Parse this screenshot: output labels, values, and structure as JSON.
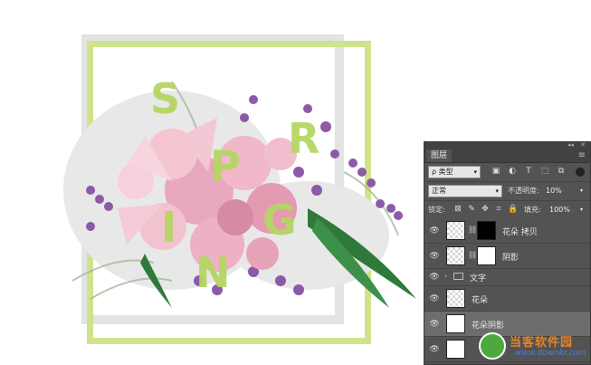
{
  "artwork": {
    "letters": [
      "S",
      "P",
      "R",
      "I",
      "N",
      "G"
    ],
    "frame_color": "#cfe38a",
    "letter_color": "#b5d664"
  },
  "panel": {
    "tab_label": "图层",
    "collapse_glyph": "◂◂",
    "close_glyph": "✕",
    "menu_glyph": "≡",
    "filter": {
      "kind_label": "类型",
      "search_glyph": "ρ",
      "icons": [
        "image-filter-icon",
        "adjustment-filter-icon",
        "type-filter-icon",
        "shape-filter-icon",
        "smart-object-filter-icon"
      ],
      "icon_glyphs": [
        "▣",
        "◐",
        "T",
        "⬚",
        "⧉"
      ]
    },
    "blend": {
      "mode": "正常",
      "opacity_label": "不透明度:",
      "opacity_value": "10%"
    },
    "lock": {
      "label": "锁定:",
      "icon_glyphs": [
        "⊠",
        "✎",
        "✥",
        "⌗",
        "🔒"
      ],
      "fill_label": "填充:",
      "fill_value": "100%"
    },
    "layers": [
      {
        "name": "花朵 拷贝",
        "type": "layer",
        "has_mask": true,
        "mask": "black",
        "visible": true,
        "selected": false
      },
      {
        "name": "阴影",
        "type": "layer",
        "has_mask": true,
        "mask": "white",
        "visible": true,
        "selected": false
      },
      {
        "name": "文字",
        "type": "group",
        "visible": true,
        "selected": false
      },
      {
        "name": "花朵",
        "type": "layer",
        "has_mask": false,
        "visible": true,
        "selected": false
      },
      {
        "name": "花朵阴影",
        "type": "layer",
        "has_mask": false,
        "visible": true,
        "selected": true
      },
      {
        "name": "",
        "type": "layer",
        "has_mask": false,
        "visible": true,
        "selected": false
      }
    ]
  },
  "watermark": {
    "title": "当客软件园",
    "url": "www.downkr.com"
  }
}
